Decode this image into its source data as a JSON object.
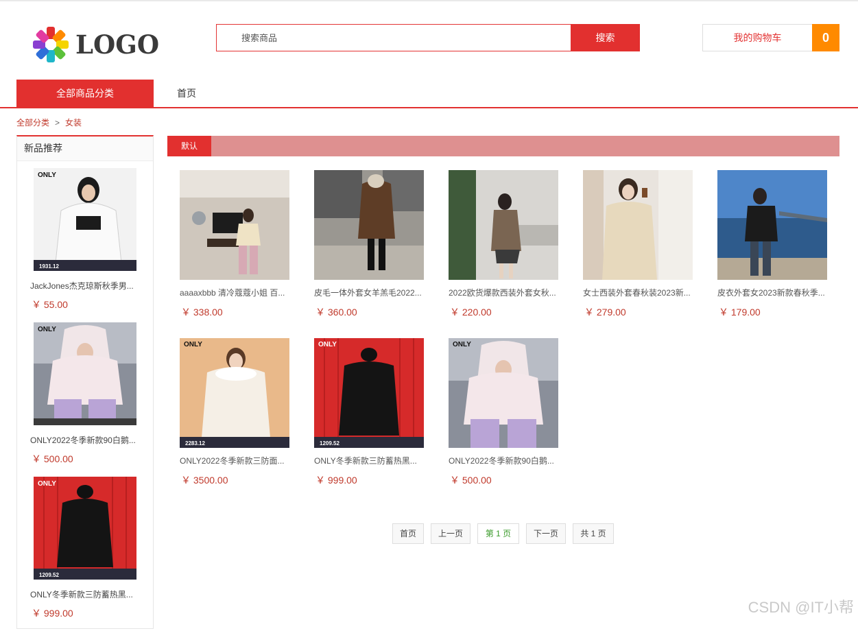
{
  "logo": {
    "text": "LOGO"
  },
  "search": {
    "placeholder": "搜索商品",
    "button_label": "搜索"
  },
  "cart": {
    "label": "我的购物车",
    "count": "0"
  },
  "nav": {
    "all_categories": "全部商品分类",
    "home": "首页"
  },
  "breadcrumb": {
    "root": "全部分类",
    "separator": ">",
    "current": "女装"
  },
  "sidebar": {
    "title": "新品推荐",
    "items": [
      {
        "name": "JackJones杰克琼斯秋季男...",
        "price": "￥ 55.00",
        "image": "white-jacket-photo"
      },
      {
        "name": "ONLY2022冬季新款90白鹅...",
        "price": "￥ 500.00",
        "image": "pink-down-parka-photo"
      },
      {
        "name": "ONLY冬季新款三防蓄热黑...",
        "price": "￥ 999.00",
        "image": "black-down-coat-photo"
      }
    ]
  },
  "sortbar": {
    "default_label": "默认"
  },
  "products": [
    {
      "name": "aaaaxbbb 清冷蔻蔻小姐 百...",
      "price": "￥ 338.00",
      "image": "cream-jacket-photo"
    },
    {
      "name": "皮毛一体外套女羊羔毛2022...",
      "price": "￥ 360.00",
      "image": "brown-leather-jacket-photo"
    },
    {
      "name": "2022欧货爆款西装外套女秋...",
      "price": "￥ 220.00",
      "image": "brown-blazer-photo"
    },
    {
      "name": "女士西装外套春秋装2023新...",
      "price": "￥ 279.00",
      "image": "beige-blazer-photo"
    },
    {
      "name": "皮衣外套女2023新款春秋季...",
      "price": "￥ 179.00",
      "image": "black-leather-coat-photo"
    },
    {
      "name": "ONLY2022冬季新款三防面...",
      "price": "￥ 3500.00",
      "image": "white-fur-parka-photo"
    },
    {
      "name": "ONLY冬季新款三防蓄热黑...",
      "price": "￥ 999.00",
      "image": "black-down-coat-photo"
    },
    {
      "name": "ONLY2022冬季新款90白鹅...",
      "price": "￥ 500.00",
      "image": "pink-down-parka-photo"
    }
  ],
  "pagination": {
    "first": "首页",
    "prev": "上一页",
    "current": "第 1 页",
    "next": "下一页",
    "total": "共 1 页"
  },
  "watermark": "CSDN @IT小帮",
  "colors": {
    "accent": "#e2302f",
    "sortbar": "#de9090",
    "cart_count_bg": "#ff8a00",
    "price": "#c0392b"
  }
}
